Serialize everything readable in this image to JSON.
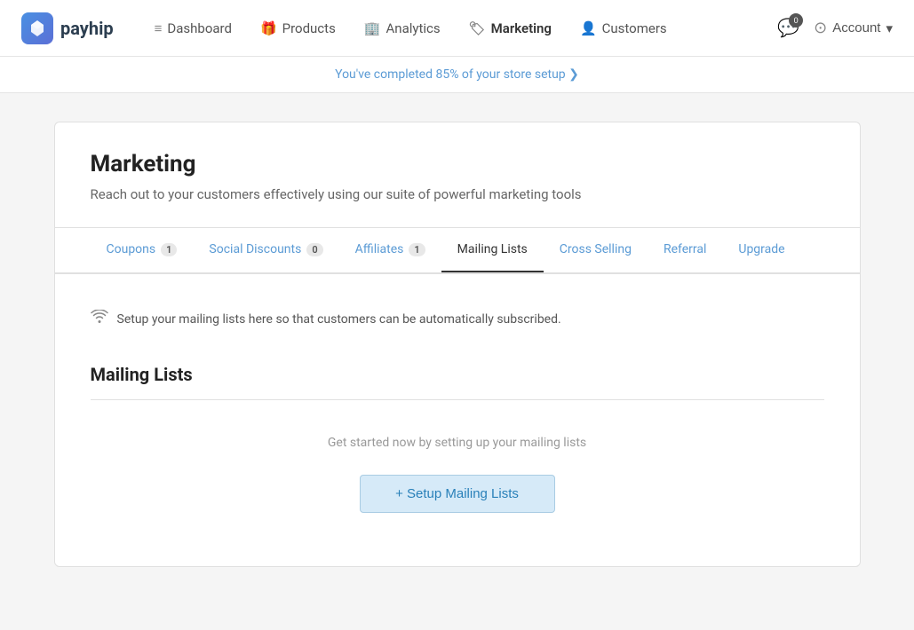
{
  "logo": {
    "symbol": "◇",
    "text": "payhip"
  },
  "nav": {
    "items": [
      {
        "id": "dashboard",
        "label": "Dashboard",
        "icon": "≡",
        "active": false
      },
      {
        "id": "products",
        "label": "Products",
        "icon": "🎁",
        "active": false
      },
      {
        "id": "analytics",
        "label": "Analytics",
        "icon": "🏢",
        "active": false
      },
      {
        "id": "marketing",
        "label": "Marketing",
        "icon": "🏷",
        "active": true
      },
      {
        "id": "customers",
        "label": "Customers",
        "icon": "👤",
        "active": false
      }
    ],
    "chat_badge": "0",
    "account_label": "Account"
  },
  "setup_bar": {
    "text": "You've completed 85% of your store setup ❯"
  },
  "header": {
    "title": "Marketing",
    "subtitle": "Reach out to your customers effectively using our suite of powerful marketing tools"
  },
  "tabs": [
    {
      "id": "coupons",
      "label": "Coupons",
      "badge": "1",
      "active": false
    },
    {
      "id": "social-discounts",
      "label": "Social Discounts",
      "badge": "0",
      "active": false
    },
    {
      "id": "affiliates",
      "label": "Affiliates",
      "badge": "1",
      "active": false
    },
    {
      "id": "mailing-lists",
      "label": "Mailing Lists",
      "badge": null,
      "active": true
    },
    {
      "id": "cross-selling",
      "label": "Cross Selling",
      "badge": null,
      "active": false
    },
    {
      "id": "referral",
      "label": "Referral",
      "badge": null,
      "active": false
    },
    {
      "id": "upgrade",
      "label": "Upgrade",
      "badge": null,
      "active": false
    }
  ],
  "content": {
    "info_text": "Setup your mailing lists here so that customers can be automatically subscribed.",
    "section_title": "Mailing Lists",
    "empty_message": "Get started now by setting up your mailing lists",
    "setup_button_label": "+ Setup Mailing Lists"
  }
}
